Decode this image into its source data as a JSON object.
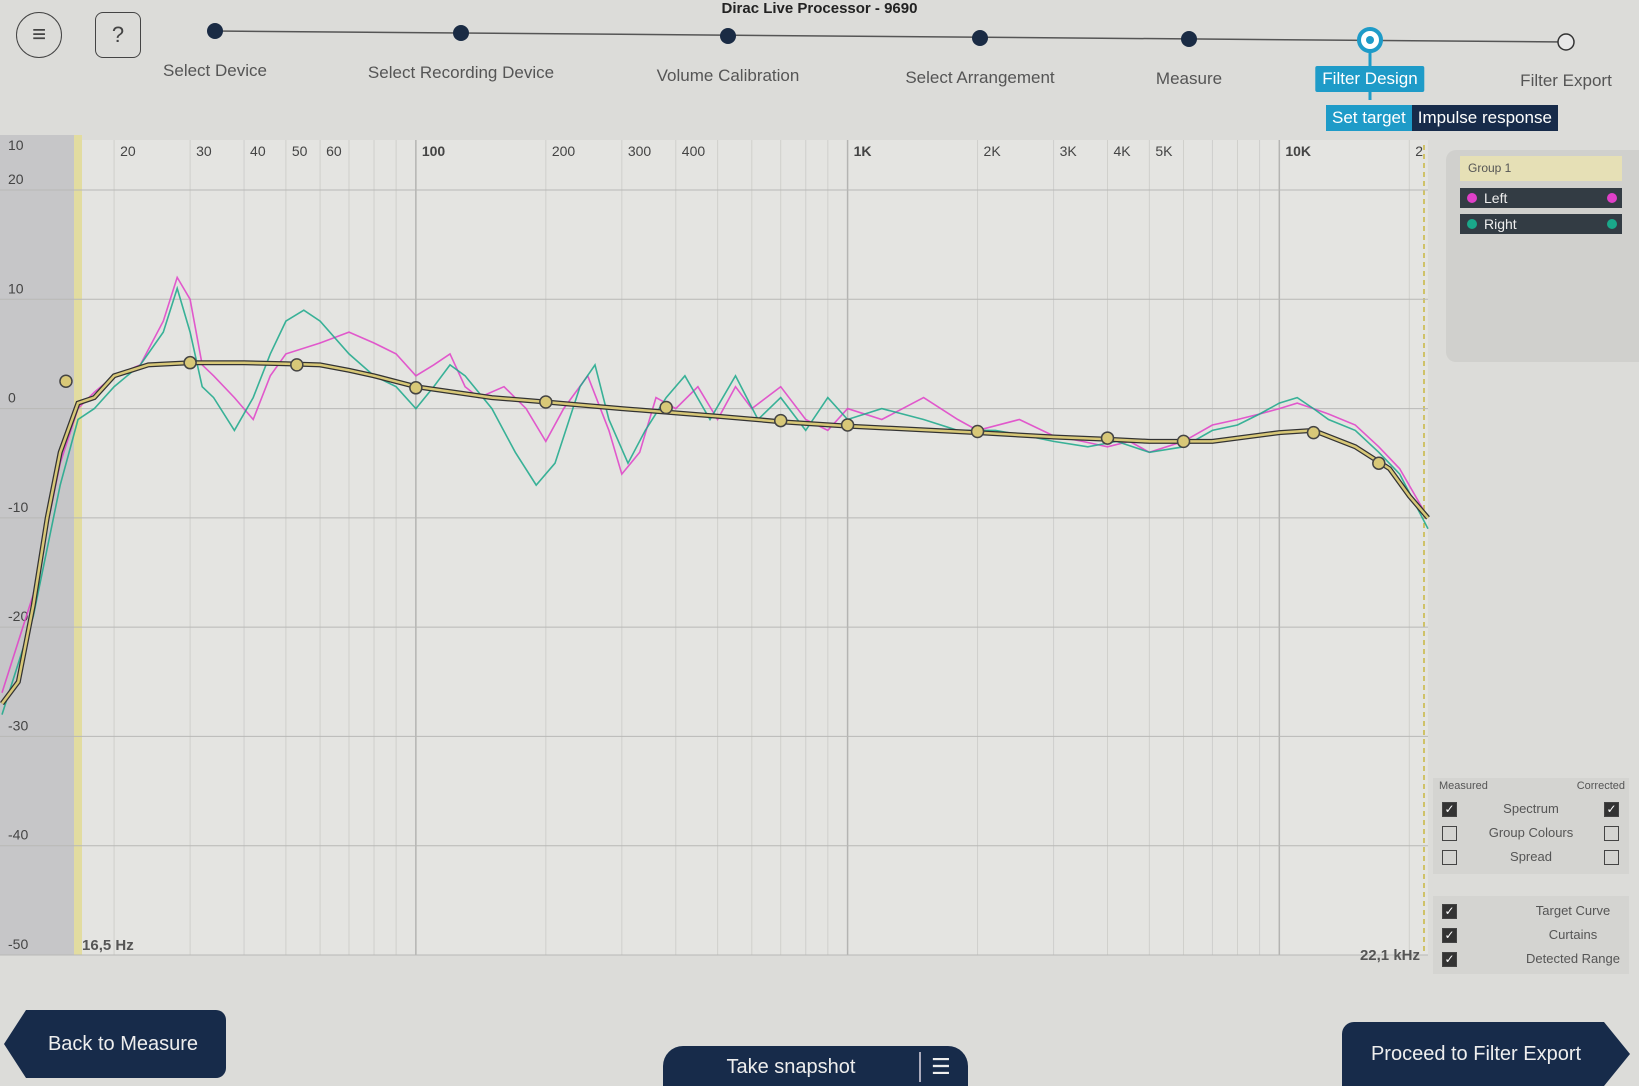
{
  "app_title": "Dirac Live Processor - 9690",
  "header": {
    "menu_icon": "hamburger-menu-icon",
    "help_label": "?",
    "steps": [
      {
        "label": "Select Device",
        "state": "done"
      },
      {
        "label": "Select Recording Device",
        "state": "done"
      },
      {
        "label": "Volume Calibration",
        "state": "done"
      },
      {
        "label": "Select Arrangement",
        "state": "done"
      },
      {
        "label": "Measure",
        "state": "done"
      },
      {
        "label": "Filter Design",
        "state": "active"
      },
      {
        "label": "Filter Export",
        "state": "pending"
      }
    ],
    "subtabs": {
      "set_target": "Set target",
      "impulse_response": "Impulse response"
    }
  },
  "colors": {
    "accent": "#1e9bc8",
    "navy": "#172b4a",
    "left": "#e040c8",
    "right": "#1aa88a",
    "target": "#d8c878"
  },
  "chart_data": {
    "type": "line",
    "x_scale": "log",
    "xlim": [
      11,
      22100
    ],
    "ylim": [
      -50,
      20
    ],
    "x_ticks": [
      {
        "value": 20,
        "label": "20"
      },
      {
        "value": 30,
        "label": "30"
      },
      {
        "value": 40,
        "label": "40"
      },
      {
        "value": 50,
        "label": "50"
      },
      {
        "value": 60,
        "label": "60"
      },
      {
        "value": 100,
        "label": "100"
      },
      {
        "value": 200,
        "label": "200"
      },
      {
        "value": 300,
        "label": "300"
      },
      {
        "value": 400,
        "label": "400"
      },
      {
        "value": 1000,
        "label": "1K"
      },
      {
        "value": 2000,
        "label": "2K"
      },
      {
        "value": 3000,
        "label": "3K"
      },
      {
        "value": 4000,
        "label": "4K"
      },
      {
        "value": 5000,
        "label": "5K"
      },
      {
        "value": 10000,
        "label": "10K"
      },
      {
        "value": 20000,
        "label": "2"
      }
    ],
    "y_ticks": [
      {
        "value": 20,
        "label": "20"
      },
      {
        "value": 10,
        "label": "10"
      },
      {
        "value": 0,
        "label": "0"
      },
      {
        "value": -10,
        "label": "-10"
      },
      {
        "value": -20,
        "label": "-20"
      },
      {
        "value": -30,
        "label": "-30"
      },
      {
        "value": -40,
        "label": "-40"
      },
      {
        "value": -50,
        "label": "-50"
      }
    ],
    "top_left_label": "10",
    "curtain_low_label": "16,5 Hz",
    "curtain_high_label": "22,1 kHz",
    "curtain_low_hz": 16.5,
    "curtain_high_hz": 22100,
    "target_curve": {
      "name": "Target Curve",
      "points": [
        [
          11,
          -27
        ],
        [
          12,
          -25
        ],
        [
          13,
          -18
        ],
        [
          14,
          -10
        ],
        [
          15,
          -4
        ],
        [
          16.5,
          0.5
        ],
        [
          18,
          1
        ],
        [
          20,
          3
        ],
        [
          24,
          4
        ],
        [
          30,
          4.2
        ],
        [
          40,
          4.2
        ],
        [
          50,
          4.1
        ],
        [
          60,
          4
        ],
        [
          70,
          3.5
        ],
        [
          80,
          3
        ],
        [
          100,
          2
        ],
        [
          150,
          1
        ],
        [
          200,
          0.6
        ],
        [
          300,
          0
        ],
        [
          500,
          -0.7
        ],
        [
          700,
          -1.2
        ],
        [
          1000,
          -1.6
        ],
        [
          2000,
          -2.2
        ],
        [
          3000,
          -2.6
        ],
        [
          4000,
          -2.8
        ],
        [
          5000,
          -3
        ],
        [
          7000,
          -3
        ],
        [
          10000,
          -2.2
        ],
        [
          12000,
          -2
        ],
        [
          15000,
          -3.5
        ],
        [
          18000,
          -5.5
        ],
        [
          20000,
          -8
        ],
        [
          22100,
          -10
        ]
      ],
      "handles": [
        [
          30,
          4.2
        ],
        [
          53,
          4
        ],
        [
          100,
          1.9
        ],
        [
          200,
          0.6
        ],
        [
          380,
          0.1
        ],
        [
          700,
          -1.1
        ],
        [
          1000,
          -1.5
        ],
        [
          2000,
          -2.1
        ],
        [
          4000,
          -2.7
        ],
        [
          6000,
          -3
        ],
        [
          12000,
          -2.2
        ],
        [
          17000,
          -5
        ]
      ],
      "gain_handle": [
        12.5,
        2.5
      ]
    },
    "series": [
      {
        "name": "Left",
        "points": [
          [
            11,
            -26
          ],
          [
            13,
            -17
          ],
          [
            15,
            -5
          ],
          [
            16.5,
            0
          ],
          [
            18,
            1.5
          ],
          [
            20,
            3
          ],
          [
            23,
            4
          ],
          [
            26,
            8
          ],
          [
            28,
            12
          ],
          [
            30,
            10
          ],
          [
            32,
            4
          ],
          [
            34,
            3
          ],
          [
            38,
            1
          ],
          [
            42,
            -1
          ],
          [
            46,
            3
          ],
          [
            50,
            5
          ],
          [
            60,
            6
          ],
          [
            70,
            7
          ],
          [
            80,
            6
          ],
          [
            90,
            5
          ],
          [
            100,
            3
          ],
          [
            110,
            4
          ],
          [
            120,
            5
          ],
          [
            130,
            2
          ],
          [
            140,
            1
          ],
          [
            160,
            2
          ],
          [
            180,
            0
          ],
          [
            200,
            -3
          ],
          [
            220,
            0
          ],
          [
            250,
            3
          ],
          [
            280,
            -2
          ],
          [
            300,
            -6
          ],
          [
            330,
            -4
          ],
          [
            360,
            1
          ],
          [
            400,
            0
          ],
          [
            450,
            2
          ],
          [
            500,
            -1
          ],
          [
            550,
            2
          ],
          [
            600,
            0
          ],
          [
            700,
            2
          ],
          [
            800,
            -1
          ],
          [
            900,
            -2
          ],
          [
            1000,
            0
          ],
          [
            1200,
            -1
          ],
          [
            1500,
            1
          ],
          [
            1800,
            -1
          ],
          [
            2000,
            -2
          ],
          [
            2500,
            -1
          ],
          [
            3000,
            -2.5
          ],
          [
            3500,
            -3
          ],
          [
            4000,
            -3.5
          ],
          [
            4500,
            -3
          ],
          [
            5000,
            -4
          ],
          [
            6000,
            -3
          ],
          [
            7000,
            -1.5
          ],
          [
            8000,
            -1
          ],
          [
            9000,
            -0.5
          ],
          [
            10000,
            0
          ],
          [
            11000,
            0.5
          ],
          [
            12000,
            0
          ],
          [
            13000,
            -0.5
          ],
          [
            15000,
            -1.5
          ],
          [
            17000,
            -3.5
          ],
          [
            19000,
            -5.5
          ],
          [
            22100,
            -10
          ]
        ]
      },
      {
        "name": "Right",
        "points": [
          [
            11,
            -28
          ],
          [
            13,
            -19
          ],
          [
            15,
            -7
          ],
          [
            16.5,
            -1
          ],
          [
            18,
            0
          ],
          [
            20,
            2
          ],
          [
            23,
            4
          ],
          [
            26,
            7
          ],
          [
            28,
            11
          ],
          [
            30,
            7
          ],
          [
            32,
            2
          ],
          [
            34,
            1
          ],
          [
            38,
            -2
          ],
          [
            42,
            1
          ],
          [
            46,
            5
          ],
          [
            50,
            8
          ],
          [
            55,
            9
          ],
          [
            60,
            8
          ],
          [
            70,
            5
          ],
          [
            80,
            3
          ],
          [
            90,
            2
          ],
          [
            100,
            0
          ],
          [
            110,
            2
          ],
          [
            120,
            4
          ],
          [
            130,
            3
          ],
          [
            150,
            0
          ],
          [
            170,
            -4
          ],
          [
            190,
            -7
          ],
          [
            210,
            -5
          ],
          [
            240,
            2
          ],
          [
            260,
            4
          ],
          [
            280,
            -1
          ],
          [
            310,
            -5
          ],
          [
            340,
            -2
          ],
          [
            380,
            1
          ],
          [
            420,
            3
          ],
          [
            480,
            -1
          ],
          [
            550,
            3
          ],
          [
            620,
            -1
          ],
          [
            700,
            1
          ],
          [
            800,
            -2
          ],
          [
            900,
            1
          ],
          [
            1000,
            -1
          ],
          [
            1200,
            0
          ],
          [
            1500,
            -1
          ],
          [
            1800,
            -2
          ],
          [
            2200,
            -2
          ],
          [
            2600,
            -2.5
          ],
          [
            3000,
            -3
          ],
          [
            3600,
            -3.5
          ],
          [
            4200,
            -3
          ],
          [
            5000,
            -4
          ],
          [
            6000,
            -3.5
          ],
          [
            7000,
            -2
          ],
          [
            8000,
            -1.5
          ],
          [
            9000,
            -0.5
          ],
          [
            10000,
            0.5
          ],
          [
            11000,
            1
          ],
          [
            12000,
            0
          ],
          [
            13000,
            -1
          ],
          [
            15000,
            -2
          ],
          [
            17000,
            -4
          ],
          [
            19000,
            -6
          ],
          [
            22100,
            -11
          ]
        ]
      }
    ],
    "grid": true,
    "legend_position": "right"
  },
  "legend": {
    "group_title": "Group 1",
    "channels": [
      {
        "label": "Left",
        "color": "#e040c8"
      },
      {
        "label": "Right",
        "color": "#1aa88a"
      }
    ]
  },
  "options": {
    "measured_label": "Measured",
    "corrected_label": "Corrected",
    "rows": [
      {
        "label": "Spectrum",
        "measured": true,
        "corrected": true
      },
      {
        "label": "Group Colours",
        "measured": false,
        "corrected": false
      },
      {
        "label": "Spread",
        "measured": false,
        "corrected": false
      }
    ],
    "toggles": [
      {
        "label": "Target Curve",
        "checked": true
      },
      {
        "label": "Curtains",
        "checked": true
      },
      {
        "label": "Detected Range",
        "checked": true
      }
    ]
  },
  "footer": {
    "back_label": "Back to Measure",
    "snapshot_label": "Take snapshot",
    "snapshot_icon": "snapshot-list-icon",
    "proceed_label": "Proceed to Filter Export"
  }
}
